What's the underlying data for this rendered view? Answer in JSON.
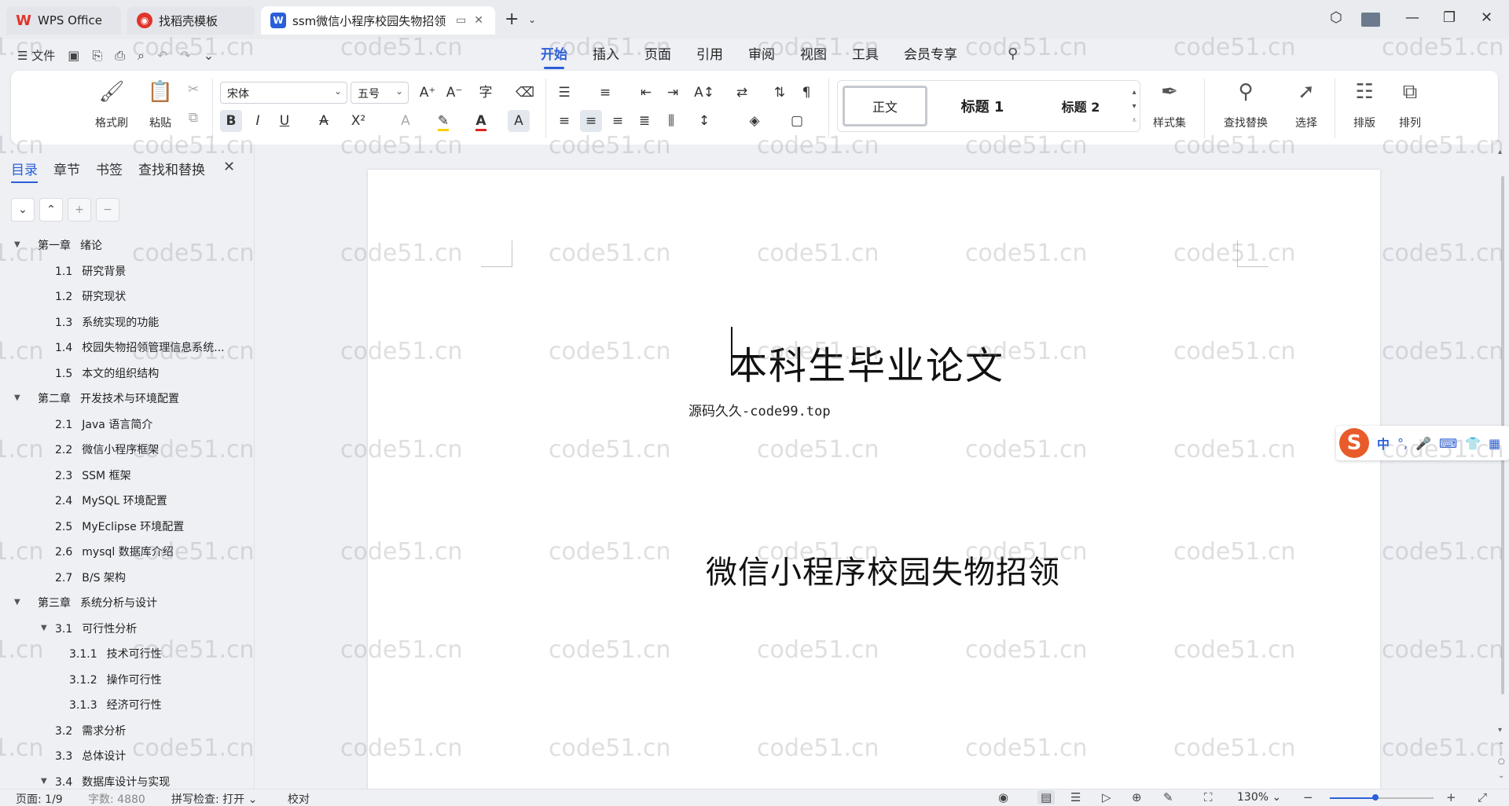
{
  "titlebar": {
    "tabs": [
      {
        "label": "WPS Office"
      },
      {
        "label": "找稻壳模板"
      },
      {
        "label": "ssm微信小程序校园失物招领"
      }
    ]
  },
  "menu": {
    "file_label": "文件",
    "tabs": [
      "开始",
      "插入",
      "页面",
      "引用",
      "审阅",
      "视图",
      "工具",
      "会员专享"
    ],
    "active_tab": "开始"
  },
  "ribbon": {
    "format_painter": "格式刷",
    "paste": "粘贴",
    "font_name": "宋体",
    "font_size": "五号",
    "styles": [
      "正文",
      "标题 1",
      "标题 2"
    ],
    "style_set": "样式集",
    "find_replace": "查找替换",
    "select": "选择",
    "layout": "排版",
    "arrange": "排列"
  },
  "nav": {
    "tabs": [
      "目录",
      "章节",
      "书签",
      "查找和替换"
    ],
    "active_tab": "目录",
    "outline": [
      {
        "num": "第一章",
        "text": "绪论",
        "level": 0,
        "expanded": true
      },
      {
        "num": "1.1",
        "text": "研究背景",
        "level": 1
      },
      {
        "num": "1.2",
        "text": "研究现状",
        "level": 1
      },
      {
        "num": "1.3",
        "text": "系统实现的功能",
        "level": 1
      },
      {
        "num": "1.4",
        "text": "校园失物招领管理信息系统...",
        "level": 1
      },
      {
        "num": "1.5",
        "text": "本文的组织结构",
        "level": 1
      },
      {
        "num": "第二章",
        "text": "开发技术与环境配置",
        "level": 0,
        "expanded": true
      },
      {
        "num": "2.1",
        "text": "Java 语言简介",
        "level": 1
      },
      {
        "num": "2.2",
        "text": "微信小程序框架",
        "level": 1
      },
      {
        "num": "2.3",
        "text": "SSM 框架",
        "level": 1
      },
      {
        "num": "2.4",
        "text": "MySQL 环境配置",
        "level": 1
      },
      {
        "num": "2.5",
        "text": "MyEclipse 环境配置",
        "level": 1
      },
      {
        "num": "2.6",
        "text": "mysql 数据库介绍",
        "level": 1
      },
      {
        "num": "2.7",
        "text": "B/S 架构",
        "level": 1
      },
      {
        "num": "第三章",
        "text": "系统分析与设计",
        "level": 0,
        "expanded": true
      },
      {
        "num": "3.1",
        "text": "可行性分析",
        "level": 1,
        "expanded": true
      },
      {
        "num": "3.1.1",
        "text": "技术可行性",
        "level": 2
      },
      {
        "num": "3.1.2",
        "text": "操作可行性",
        "level": 2
      },
      {
        "num": "3.1.3",
        "text": "经济可行性",
        "level": 2
      },
      {
        "num": "3.2",
        "text": "需求分析",
        "level": 1
      },
      {
        "num": "3.3",
        "text": "总体设计",
        "level": 1
      },
      {
        "num": "3.4",
        "text": "数据库设计与实现",
        "level": 1,
        "expanded": true
      }
    ]
  },
  "document": {
    "title": "本科生毕业论文",
    "subtitle": "源码久久-code99.top",
    "project_name": "微信小程序校园失物招领"
  },
  "ime": {
    "mode": "中"
  },
  "watermark": "code51.cn",
  "status": {
    "page": "页面: 1/9",
    "word_count": "字数: 4880",
    "spell_check": "拼写检查: 打开",
    "proofread": "校对",
    "zoom": "130%",
    "zoom_fraction": 0.44
  },
  "colors": {
    "accent": "#2b5fd9",
    "wps_red": "#e0342b",
    "ime_orange": "#e85b2a"
  }
}
